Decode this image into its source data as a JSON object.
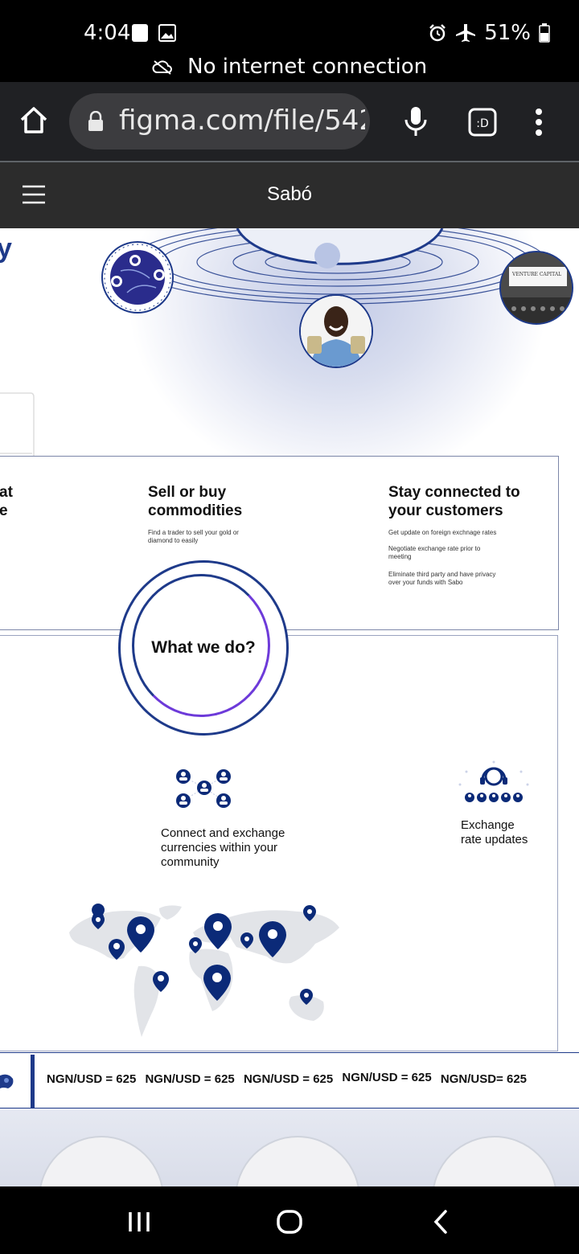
{
  "status_bar": {
    "time": "4:04",
    "network_notice": "No internet connection",
    "battery": "51%"
  },
  "browser": {
    "url": "figma.com/file/542",
    "icons": [
      "home-icon",
      "lock-icon",
      "mic-icon",
      "tab-switcher-icon",
      "more-vert-icon"
    ]
  },
  "app_bar": {
    "title": "Sabó"
  },
  "hero": {
    "badge_text": "VENTURE CAPITAL",
    "partial_heading": "y"
  },
  "features": {
    "left_partial_1": "at",
    "left_partial_2": "e",
    "sell": {
      "title_line1": "Sell or buy",
      "title_line2": "commodities",
      "desc_line1": "Find a trader to sell your gold or",
      "desc_line2": "diamond  to easily"
    },
    "stay": {
      "title_line1": "Stay connected to",
      "title_line2": "your customers",
      "bullet1": "Get update on foreign exchnage rates",
      "bullet2_line1": "Negotiate exchange rate prior to",
      "bullet2_line2": "meeting",
      "bullet3_line1": "Eliminate third party and have privacy",
      "bullet3_line2": "over your funds with Sabo"
    }
  },
  "what_we_do": {
    "title": "What we do?",
    "community_line1": "Connect and exchange",
    "community_line2": "currencies within your",
    "community_line3": "community",
    "rate_line1": "Exchange",
    "rate_line2": "rate updates"
  },
  "ticker": {
    "items": [
      "NGN/USD = 625",
      "NGN/USD = 625",
      "NGN/USD = 625",
      "NGN/USD = 625",
      "NGN/USD= 625"
    ]
  },
  "colors": {
    "brand": "#1e3a8a",
    "accent": "#6d3ad9",
    "pin": "#0b2a78"
  }
}
